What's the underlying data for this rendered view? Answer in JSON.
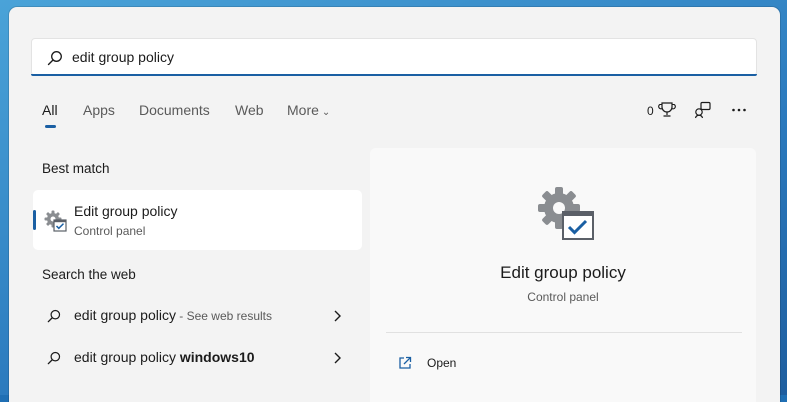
{
  "search": {
    "value": "edit group policy",
    "icon": "search-icon"
  },
  "tabs": [
    {
      "label": "All",
      "active": true
    },
    {
      "label": "Apps"
    },
    {
      "label": "Documents"
    },
    {
      "label": "Web"
    },
    {
      "label": "More"
    }
  ],
  "toolbar": {
    "rewards_count": "0",
    "rewards_icon": "trophy-icon",
    "devices_icon": "devices-icon",
    "more_icon": "ellipsis-icon"
  },
  "best_match": {
    "section_title": "Best match",
    "item": {
      "title": "Edit group policy",
      "subtitle": "Control panel",
      "icon": "gear-check-icon"
    }
  },
  "web_search": {
    "section_title": "Search the web",
    "items": [
      {
        "query": "edit group policy",
        "bold_suffix": "",
        "hint": " - See web results"
      },
      {
        "query": "edit group policy ",
        "bold_suffix": "windows10",
        "hint": ""
      }
    ]
  },
  "details": {
    "title": "Edit group policy",
    "subtitle": "Control panel",
    "actions": [
      {
        "label": "Open",
        "icon": "open-external-icon"
      }
    ]
  },
  "colors": {
    "accent": "#1a5fa3",
    "panel": "#f3f3f3",
    "pane": "#f9f9f9"
  }
}
